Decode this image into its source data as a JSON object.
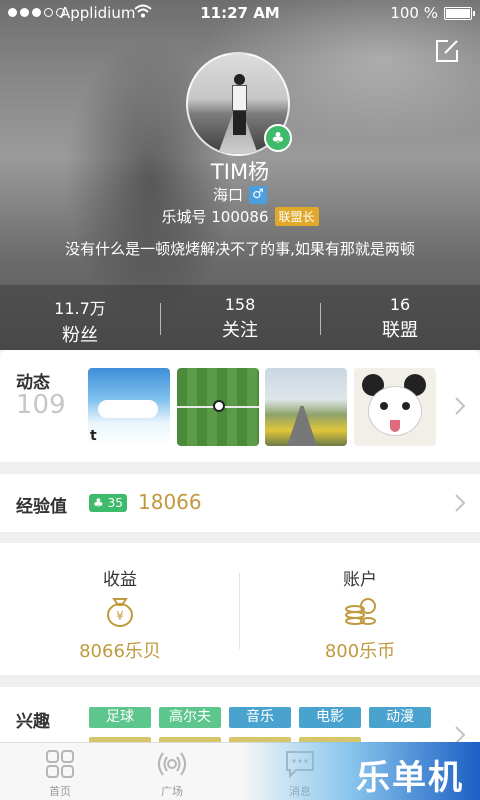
{
  "status_bar": {
    "carrier": "Applidium",
    "time": "11:27 AM",
    "battery": "100 %",
    "signal_icon": "signal-dots-icon",
    "wifi_icon": "wifi-icon",
    "battery_icon": "battery-icon"
  },
  "header": {
    "edit_icon": "edit-icon"
  },
  "profile": {
    "name": "TIM杨",
    "location": "海口",
    "gender_symbol": "♂",
    "id_line": "乐城号 100086",
    "role_tag": "联盟长",
    "motto": "没有什么是一顿烧烤解决不了的事,如果有那就是两顿",
    "club_badge_icon": "club-icon",
    "club_symbol": "♣"
  },
  "stats": [
    {
      "num": "11.7万",
      "label": "粉丝"
    },
    {
      "num": "158",
      "label": "关注"
    },
    {
      "num": "16",
      "label": "联盟"
    }
  ],
  "dynamic": {
    "title": "动态",
    "count": "109",
    "thumb_caption": "t"
  },
  "experience": {
    "title": "经验值",
    "level_symbol": "♣",
    "level": "35",
    "value": "18066"
  },
  "money": {
    "earnings_title": "收益",
    "earnings_value": "8066乐贝",
    "account_title": "账户",
    "account_value": "800乐币",
    "earnings_icon": "money-bag-icon",
    "account_icon": "coins-stack-icon"
  },
  "interests": {
    "title": "兴趣",
    "tags": [
      {
        "label": "足球",
        "color": "#5cc68c"
      },
      {
        "label": "高尔夫",
        "color": "#5cc68c"
      },
      {
        "label": "音乐",
        "color": "#4aa3cf"
      },
      {
        "label": "电影",
        "color": "#4aa3cf"
      },
      {
        "label": "动漫",
        "color": "#4aa3cf"
      }
    ]
  },
  "tabbar": {
    "home": "首页",
    "square": "广场",
    "messages": "消息",
    "home_icon": "grid-icon",
    "square_icon": "broadcast-icon",
    "messages_icon": "chat-bubble-icon"
  },
  "promo": {
    "text": "乐单机"
  },
  "colors": {
    "accent_gold": "#c09a3e",
    "badge_green": "#3dba6a",
    "tag_green": "#5cc68c",
    "tag_blue": "#4aa3cf",
    "role_tag_gold": "#e0a92b",
    "gender_blue": "#4a9fe0"
  }
}
